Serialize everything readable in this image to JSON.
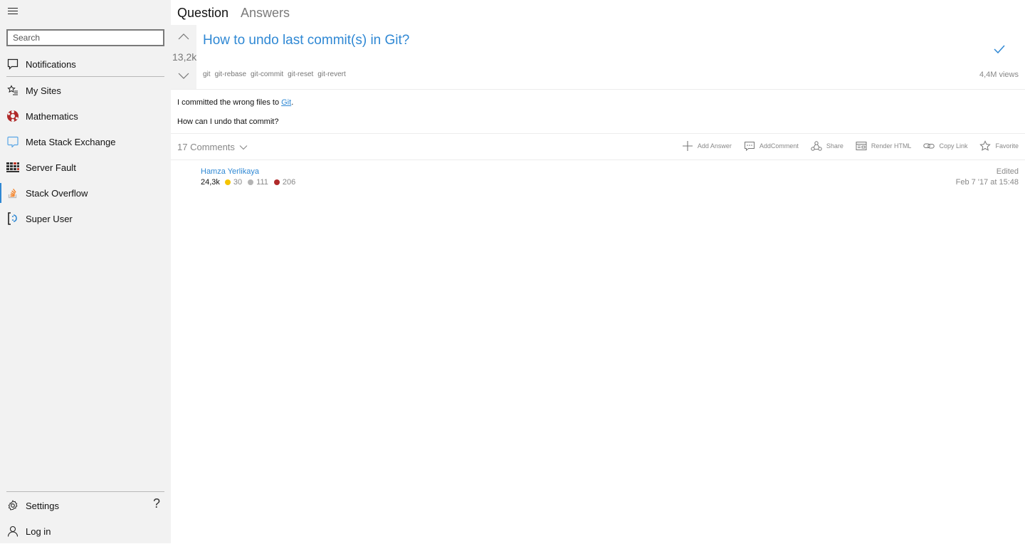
{
  "sidebar": {
    "search_placeholder": "Search",
    "items": [
      {
        "label": "Notifications",
        "icon": "notification-icon"
      },
      {
        "label": "My Sites",
        "icon": "star-list-icon"
      },
      {
        "label": "Mathematics",
        "icon": "mathematics-logo-icon"
      },
      {
        "label": "Meta Stack Exchange",
        "icon": "meta-stack-exchange-logo-icon"
      },
      {
        "label": "Server Fault",
        "icon": "server-fault-logo-icon"
      },
      {
        "label": "Stack Overflow",
        "icon": "stack-overflow-logo-icon"
      },
      {
        "label": "Super User",
        "icon": "super-user-logo-icon"
      }
    ],
    "bottom": {
      "settings_label": "Settings",
      "help_label": "?",
      "login_label": "Log in"
    }
  },
  "tabs": {
    "question": "Question",
    "answers": "Answers"
  },
  "question": {
    "score": "13,2k",
    "title": "How to undo last commit(s) in Git?",
    "tags": [
      "git",
      "git-rebase",
      "git-commit",
      "git-reset",
      "git-revert"
    ],
    "views": "4,4M views",
    "body_line1_prefix": "I committed the wrong files to ",
    "body_line1_link": "Git",
    "body_line1_suffix": ".",
    "body_line2": "How can I undo that commit?",
    "comments_label": "17 Comments"
  },
  "actions": [
    {
      "label": "Add Answer",
      "icon": "plus-icon"
    },
    {
      "label": "AddComment",
      "icon": "comment-icon"
    },
    {
      "label": "Share",
      "icon": "share-icon"
    },
    {
      "label": "Render HTML",
      "icon": "render-html-icon"
    },
    {
      "label": "Copy Link",
      "icon": "link-icon"
    },
    {
      "label": "Favorite",
      "icon": "star-icon"
    }
  ],
  "author": {
    "name": "Hamza Yerlikaya",
    "reputation": "24,3k",
    "gold": "30",
    "silver": "111",
    "bronze": "206",
    "edited_label": "Edited",
    "edited_date": "Feb 7 '17 at 15:48"
  },
  "colors": {
    "accent": "#2f88d4",
    "gold": "#f5c400",
    "silver": "#b4b4b4",
    "bronze": "#b02a2a",
    "sidebar_bg": "#f2f2f2"
  }
}
